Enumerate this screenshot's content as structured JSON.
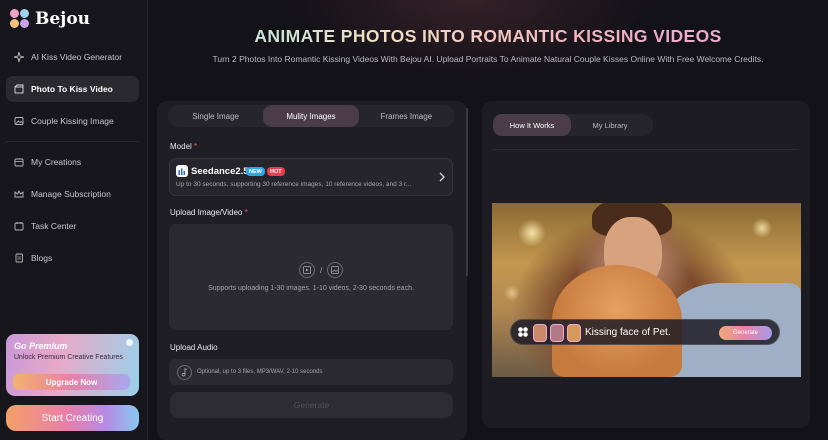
{
  "brand": {
    "name": "Bejou"
  },
  "sidebar": {
    "items": [
      {
        "label": "AI Kiss Video Generator",
        "icon": "sparkle-icon"
      },
      {
        "label": "Photo To Kiss Video",
        "icon": "clapperboard-icon",
        "active": true
      },
      {
        "label": "Couple Kissing Image",
        "icon": "image-icon"
      },
      {
        "label": "My Creations",
        "icon": "folder-icon"
      },
      {
        "label": "Manage Subscription",
        "icon": "crown-icon"
      },
      {
        "label": "Task Center",
        "icon": "calendar-icon"
      },
      {
        "label": "Blogs",
        "icon": "document-icon"
      }
    ],
    "premium": {
      "title": "Go Premium",
      "subtitle": "Unlock Premium Creative Features",
      "button": "Upgrade Now"
    },
    "start_button": "Start Creating"
  },
  "header": {
    "title": "ANIMATE PHOTOS INTO ROMANTIC KISSING VIDEOS",
    "subtitle": "Turn 2 Photos Into Romantic Kissing Videos With Bejou AI. Upload Portraits To Animate Natural Couple Kisses Online With Free Welcome Credits."
  },
  "form": {
    "tabs": [
      "Single Image",
      "Mulity Images",
      "Frames Image"
    ],
    "active_tab": 1,
    "model_label": "Model",
    "model": {
      "name": "Seedance2.5",
      "tags": [
        {
          "text": "NEW",
          "color": "#2fa6e8"
        },
        {
          "text": "HOT",
          "color": "#ea3b4f"
        }
      ],
      "description": "Up to 30 seconds, supporting 30 reference images, 10 reference videos, and 3 r..."
    },
    "upload_label": "Upload Image/Video",
    "upload_separator": "/",
    "upload_hint": "Supports uploading 1-30 images. 1-10 videos, 2-30 seconds each.",
    "audio_label": "Upload Audio",
    "audio_hint": "Optional, up to 3 files, MP3/WAV, 2-10 seconds",
    "required_mark": "*",
    "generate_button": "Generate"
  },
  "preview_panel": {
    "tabs": [
      "How It Works",
      "My Library"
    ],
    "active_tab": 0,
    "caption": "Kissing face of Pet.",
    "generate_button": "Generate"
  }
}
